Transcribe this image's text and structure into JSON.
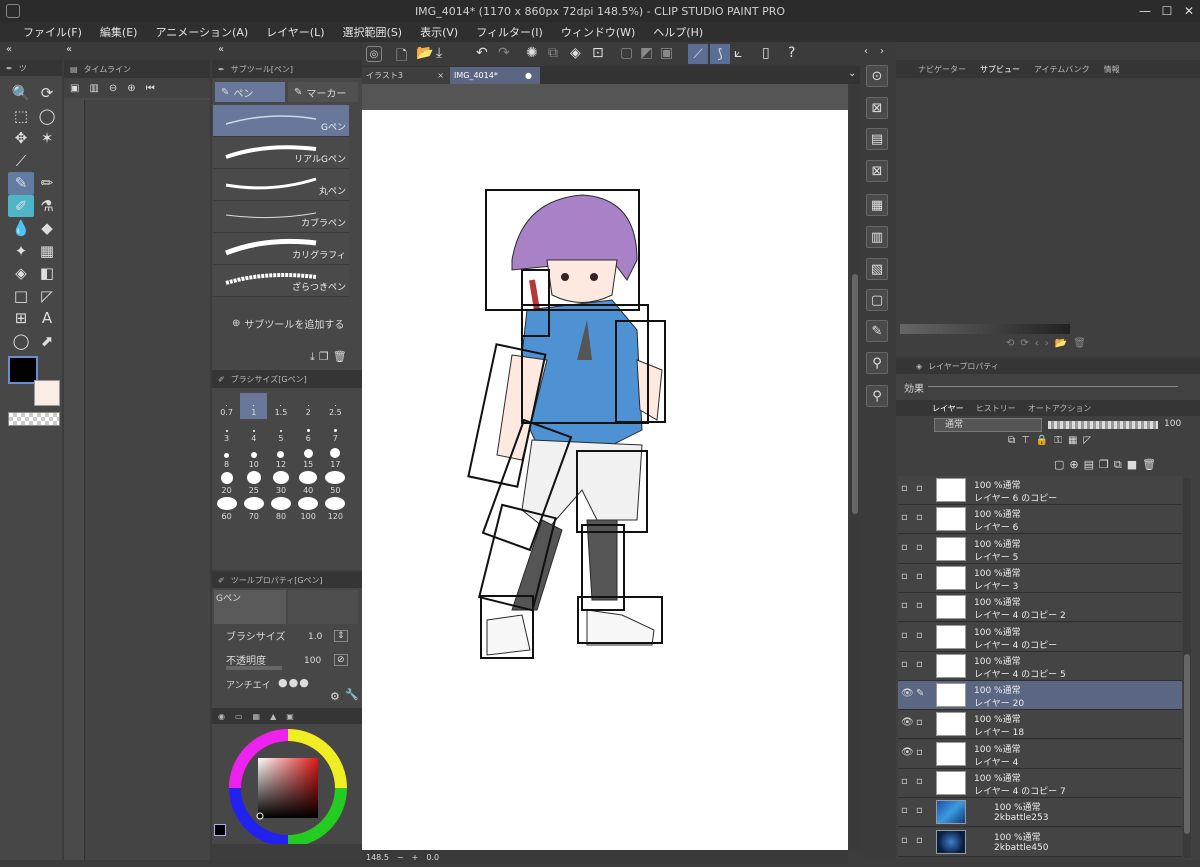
{
  "window": {
    "title": "IMG_4014* (1170 x 860px 72dpi 148.5%) - CLIP STUDIO PAINT PRO",
    "controls": [
      "—",
      "☐",
      "✕"
    ]
  },
  "menu": [
    "ファイル(F)",
    "編集(E)",
    "アニメーション(A)",
    "レイヤー(L)",
    "選択範囲(S)",
    "表示(V)",
    "フィルター(I)",
    "ウィンドウ(W)",
    "ヘルプ(H)"
  ],
  "panels": {
    "tool_header": "ツ",
    "timeline_header": "タイムライン",
    "subtool_header": "サブツール[ペン]",
    "brushsize_header": "ブラシサイズ[Gペン]",
    "toolprop_header": "ツールプロパティ[Gペン]"
  },
  "subtool": {
    "tabs": [
      "ペン",
      "マーカー"
    ],
    "items": [
      "Gペン",
      "リアルGペン",
      "丸ペン",
      "カブラペン",
      "カリグラフィ",
      "ざらつきペン"
    ],
    "add_label": "サブツールを追加する"
  },
  "brush_sizes": [
    "0.7",
    "1",
    "1.5",
    "2",
    "2.5",
    "3",
    "4",
    "5",
    "6",
    "7",
    "8",
    "10",
    "12",
    "15",
    "17",
    "20",
    "25",
    "30",
    "40",
    "50",
    "60",
    "70",
    "80",
    "100",
    "120"
  ],
  "tool_property": {
    "preset_name": "Gペン",
    "brush_size_label": "ブラシサイズ",
    "brush_size_value": "1.0",
    "opacity_label": "不透明度",
    "opacity_value": "100",
    "antialias_label": "アンチエイ"
  },
  "documents": {
    "tabs": [
      "イラスト3",
      "IMG_4014*"
    ],
    "close_glyph": "×",
    "active_marker": "●"
  },
  "status": {
    "zoom": "148.5",
    "angle": "0.0"
  },
  "right_panel": {
    "top_tabs": [
      "ナビゲーター",
      "サブビュー",
      "アイテムバンク",
      "情報"
    ],
    "layer_property_tab": "レイヤープロパティ",
    "effect_label": "効果",
    "layer_tabs": [
      "レイヤー",
      "ヒストリー",
      "オートアクション"
    ],
    "blend_mode": "通常",
    "opacity": "100"
  },
  "layers": [
    {
      "mode": "100 %通常",
      "name": "レイヤー 6 のコピー",
      "visible": false,
      "thumb": "white"
    },
    {
      "mode": "100 %通常",
      "name": "レイヤー 6",
      "visible": false,
      "thumb": "white"
    },
    {
      "mode": "100 %通常",
      "name": "レイヤー 5",
      "visible": false,
      "thumb": "white"
    },
    {
      "mode": "100 %通常",
      "name": "レイヤー 3",
      "visible": false,
      "thumb": "white"
    },
    {
      "mode": "100 %通常",
      "name": "レイヤー 4 のコピー 2",
      "visible": false,
      "thumb": "white"
    },
    {
      "mode": "100 %通常",
      "name": "レイヤー 4 のコピー",
      "visible": false,
      "thumb": "white"
    },
    {
      "mode": "100 %通常",
      "name": "レイヤー 4 のコピー 5",
      "visible": false,
      "thumb": "white"
    },
    {
      "mode": "100 %通常",
      "name": "レイヤー 20",
      "visible": true,
      "active": true,
      "thumb": "white"
    },
    {
      "mode": "100 %通常",
      "name": "レイヤー 18",
      "visible": true,
      "thumb": "white"
    },
    {
      "mode": "100 %通常",
      "name": "レイヤー 4",
      "visible": true,
      "thumb": "white"
    },
    {
      "mode": "100 %通常",
      "name": "レイヤー 4 のコピー 7",
      "visible": false,
      "thumb": "white"
    },
    {
      "mode": "100 %通常",
      "name": "2kbattle253",
      "visible": false,
      "thumb": "blue"
    },
    {
      "mode": "100 %通常",
      "name": "2kbattle450",
      "visible": false,
      "thumb": "dark"
    }
  ]
}
